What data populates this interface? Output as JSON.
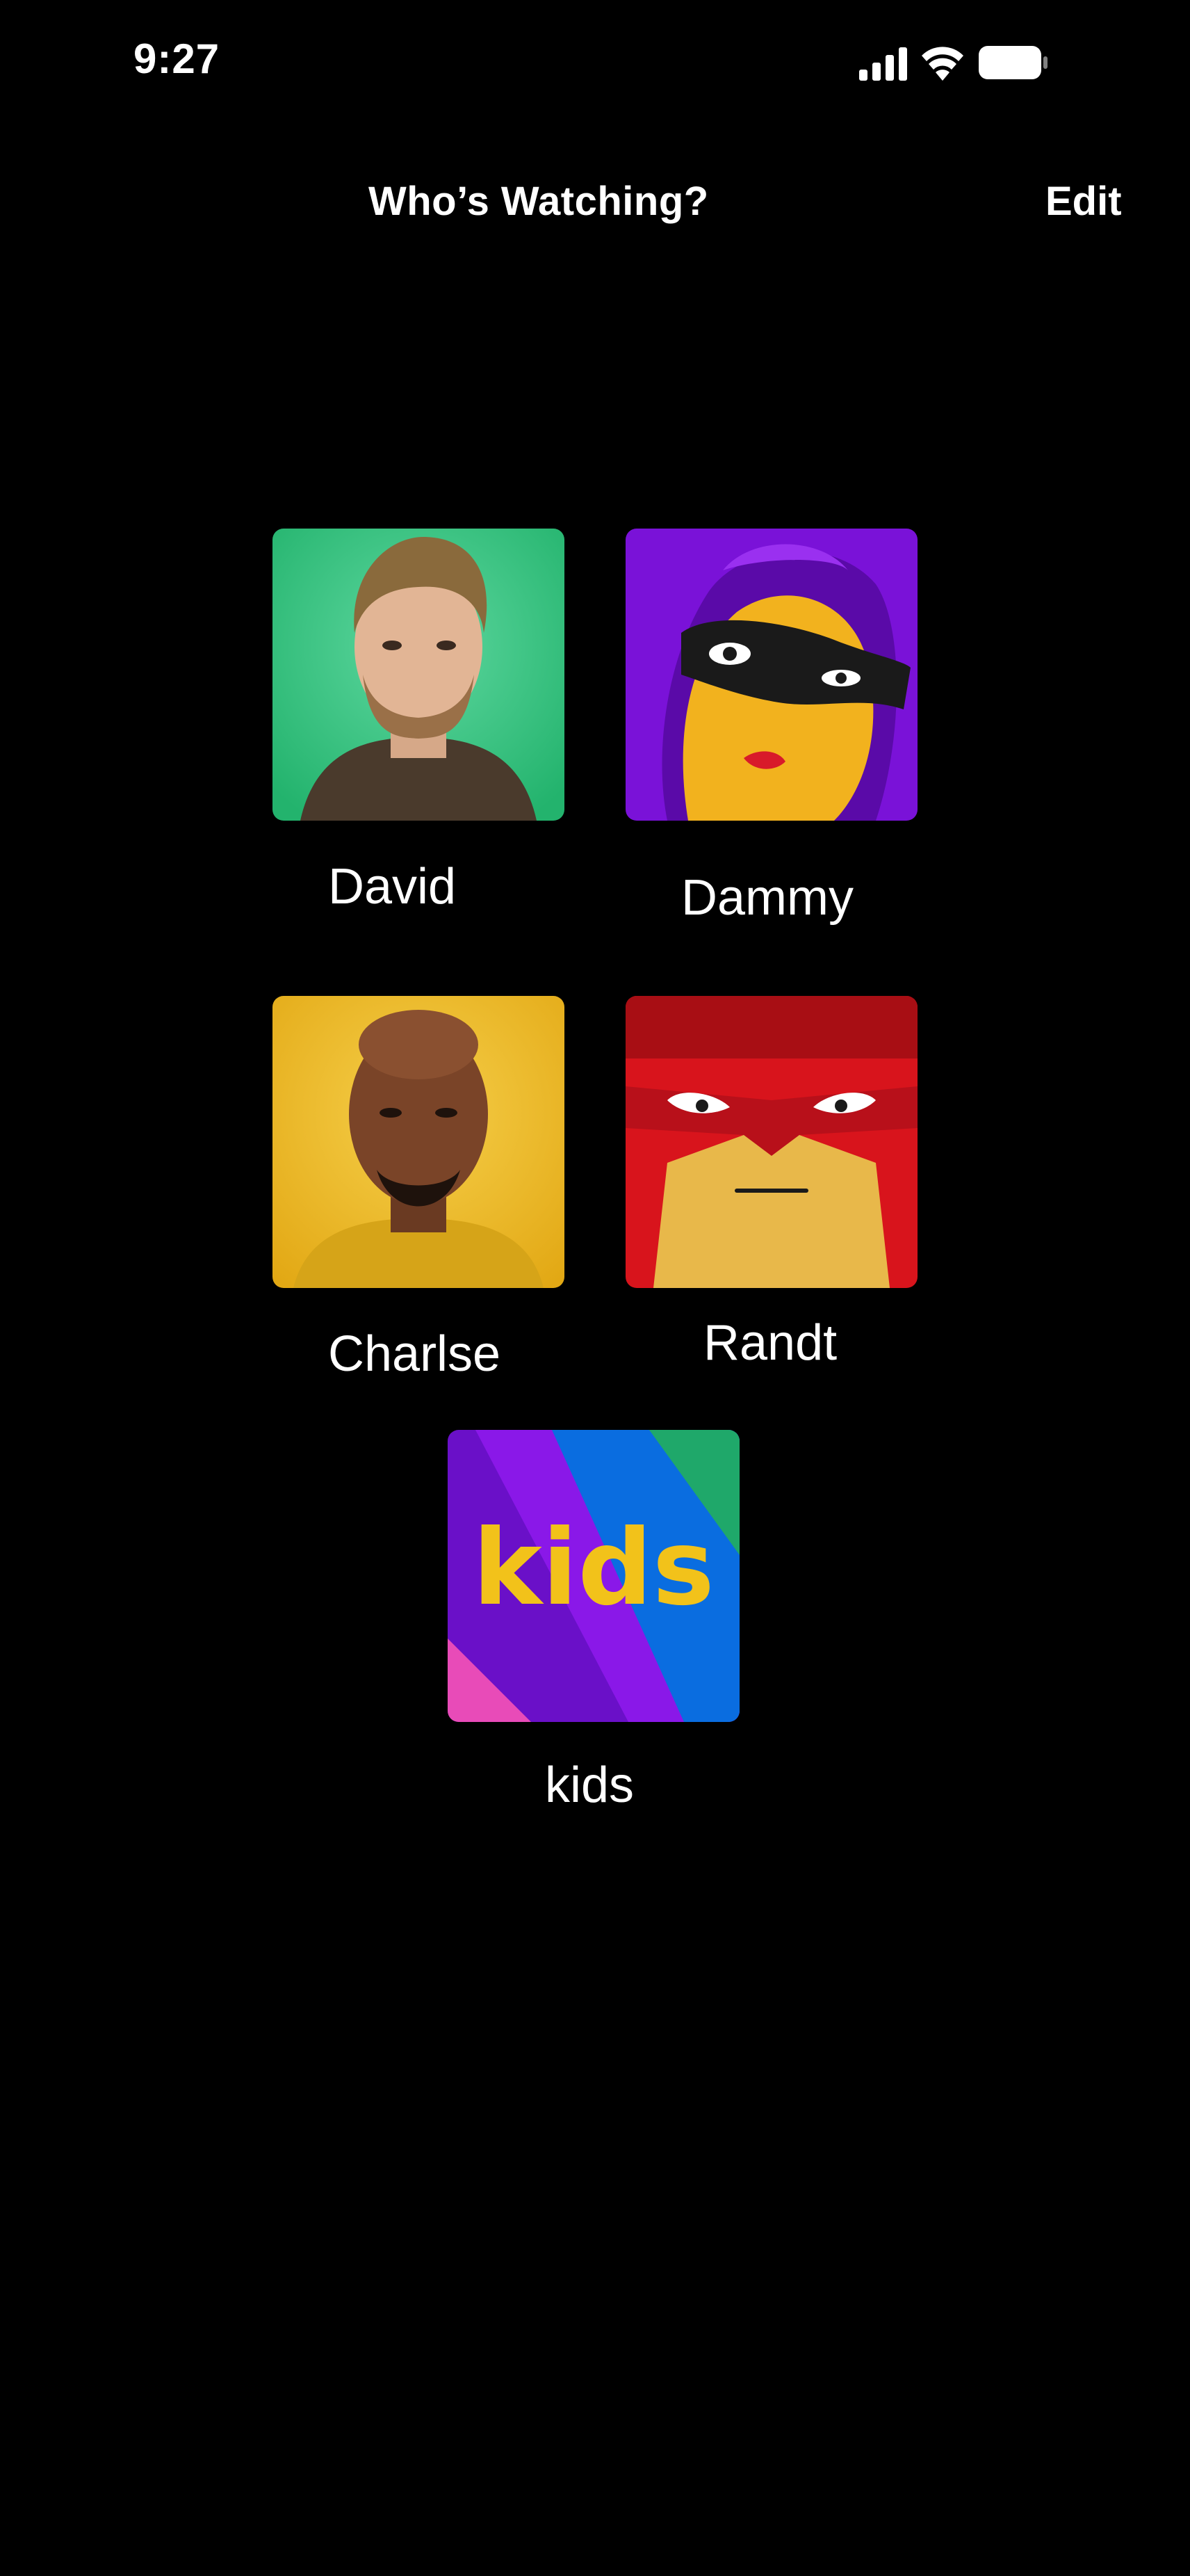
{
  "status_bar": {
    "time": "9:27",
    "icons": [
      "signal-icon",
      "wifi-icon",
      "battery-icon"
    ]
  },
  "header": {
    "title": "Who’s Watching?",
    "edit_label": "Edit"
  },
  "profiles": [
    {
      "name": "David",
      "avatar": "portrait-green-background"
    },
    {
      "name": "Dammy",
      "avatar": "masked-cartoon-purple"
    },
    {
      "name": "Charlse",
      "avatar": "portrait-yellow-background"
    },
    {
      "name": "Randt",
      "avatar": "masked-cartoon-red"
    },
    {
      "name": "kids",
      "avatar": "kids-logo",
      "logo_text": "kids"
    }
  ],
  "colors": {
    "background": "#000000",
    "text": "#ffffff",
    "green": "#2fbf7a",
    "purple": "#7a12d8",
    "yellow": "#e9b21a",
    "red": "#d8141c",
    "kids_blue": "#0a6de0"
  }
}
